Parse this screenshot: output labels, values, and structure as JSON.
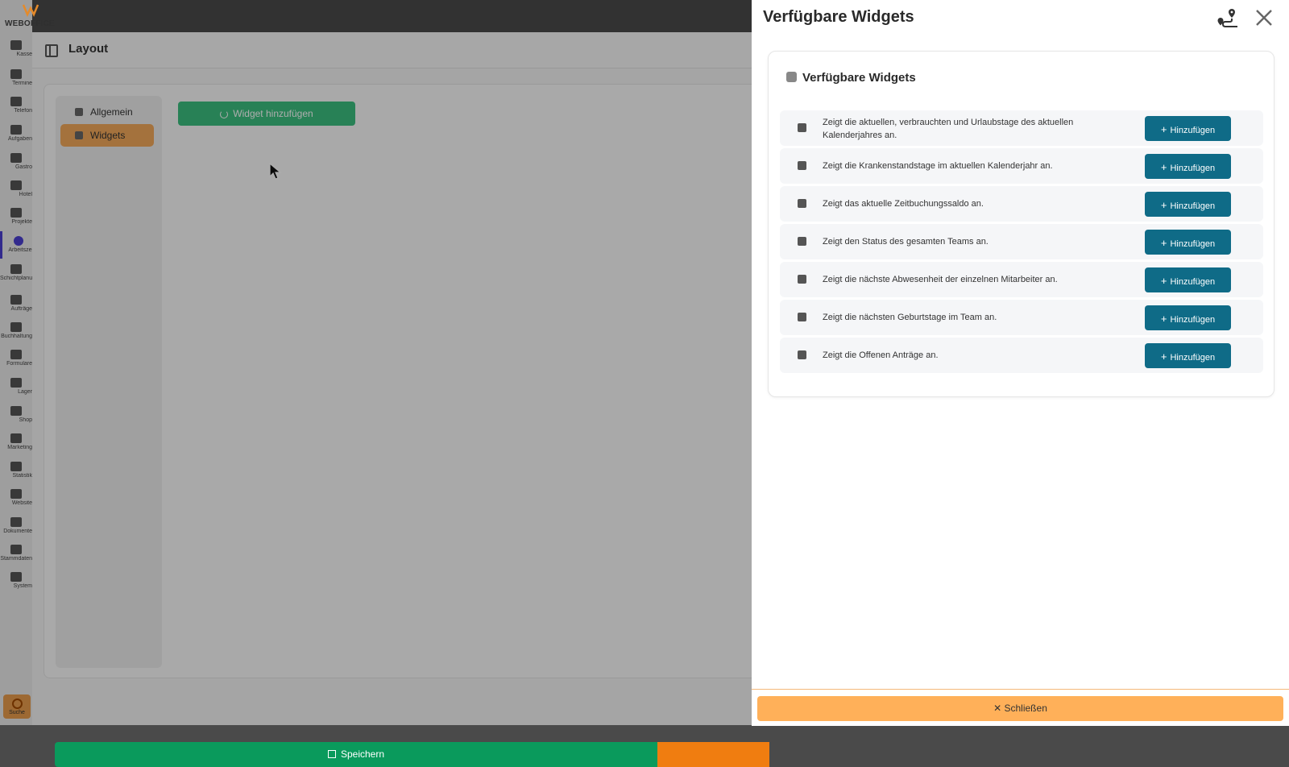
{
  "app": {
    "brand": "WEBOFFICE"
  },
  "rail": {
    "items": [
      {
        "label": "Kasse"
      },
      {
        "label": "Termine"
      },
      {
        "label": "Telefon"
      },
      {
        "label": "Aufgaben"
      },
      {
        "label": "Gastro"
      },
      {
        "label": "Hotel"
      },
      {
        "label": "Projekte"
      },
      {
        "label": "Arbeitszeit"
      },
      {
        "label": "Schichtplanung"
      },
      {
        "label": "Aufträge"
      },
      {
        "label": "Buchhaltung"
      },
      {
        "label": "Formulare"
      },
      {
        "label": "Lager"
      },
      {
        "label": "Shop"
      },
      {
        "label": "Marketing"
      },
      {
        "label": "Statistik"
      },
      {
        "label": "Website"
      },
      {
        "label": "Dokumente"
      },
      {
        "label": "Stammdaten"
      },
      {
        "label": "System"
      }
    ],
    "search_label": "Suche"
  },
  "layout": {
    "title": "Layout",
    "menu": [
      {
        "label": "Allgemein"
      },
      {
        "label": "Widgets"
      }
    ],
    "add_widget_label": "Widget hinzufügen",
    "save_label": "Speichern"
  },
  "drawer": {
    "title": "Verfügbare Widgets",
    "card_title": "Verfügbare Widgets",
    "add_label": "Hinzufügen",
    "widgets": [
      {
        "icon": "umbrella-beach-icon",
        "description": "Zeigt die aktuellen, verbrauchten und Urlaubstage des aktuellen Kalenderjahres an."
      },
      {
        "icon": "syringe-icon",
        "description": "Zeigt die Krankenstandstage im aktuellen Kalenderjahr an."
      },
      {
        "icon": "hourglass-icon",
        "description": "Zeigt das aktuelle Zeitbuchungssaldo an."
      },
      {
        "icon": "traffic-light-icon",
        "description": "Zeigt den Status des gesamten Teams an."
      },
      {
        "icon": "calendar-icon",
        "description": "Zeigt die nächste Abwesenheit der einzelnen Mitarbeiter an."
      },
      {
        "icon": "cake-icon",
        "description": "Zeigt die nächsten Geburtstage im Team an."
      },
      {
        "icon": "calendar-clock-icon",
        "description": "Zeigt die Offenen Anträge an."
      }
    ],
    "close_label": "Schließen"
  },
  "colors": {
    "primary_button": "#0f6b87",
    "save_green": "#0a9a5c",
    "close_orange": "#ffb059",
    "active_menu": "#f2a95a"
  }
}
